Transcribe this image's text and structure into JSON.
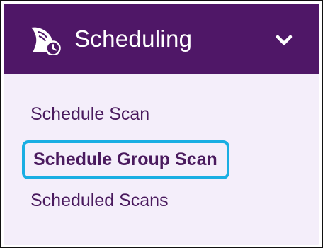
{
  "menu": {
    "header": {
      "title": "Scheduling",
      "icon": "shark-fin-clock-icon",
      "toggle_icon": "chevron-down-icon"
    },
    "items": [
      {
        "label": "Schedule Scan",
        "selected": false
      },
      {
        "label": "Schedule Group Scan",
        "selected": true
      },
      {
        "label": "Scheduled Scans",
        "selected": false
      }
    ]
  },
  "colors": {
    "header_bg": "#4f1767",
    "panel_bg": "#f4eefa",
    "text": "#4a1a5e",
    "highlight": "#1aaee3"
  }
}
